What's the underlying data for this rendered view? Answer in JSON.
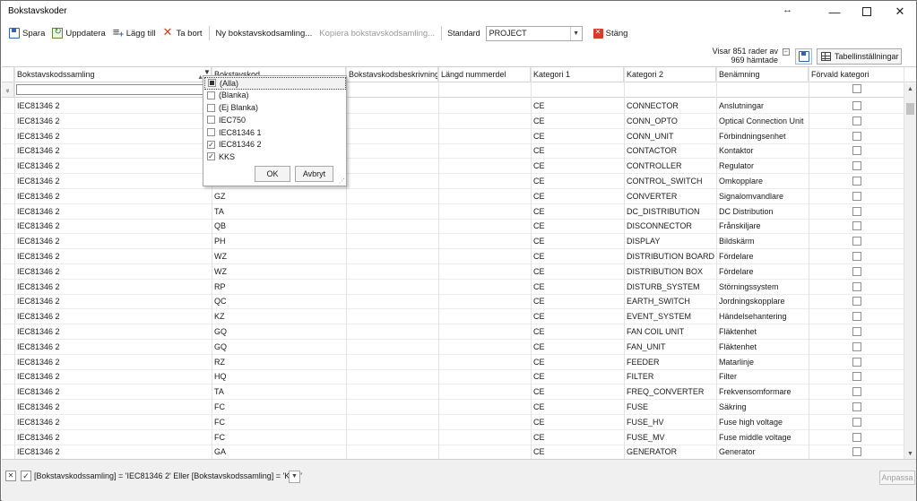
{
  "window": {
    "title": "Bokstavskoder"
  },
  "toolbar": {
    "save": "Spara",
    "update": "Uppdatera",
    "add": "Lägg till",
    "delete": "Ta bort",
    "new_collection": "Ny bokstavskodsamling...",
    "copy_collection": "Kopiera bokstavskodsamling...",
    "standard_label": "Standard",
    "standard_value": "PROJECT",
    "close": "Stäng"
  },
  "info": {
    "rows_line1": "Visar 851 rader av",
    "rows_line2": "969 hämtade",
    "settings_button": "Tabellinställningar"
  },
  "columns": [
    "Bokstavskodssamling",
    "Bokstavskod",
    "Bokstavskodsbeskrivning",
    "Längd nummerdel",
    "Kategori 1",
    "Kategori 2",
    "Benämning",
    "Förvald kategori"
  ],
  "rows": [
    {
      "collection": "IEC81346 2",
      "code": "",
      "cat1": "CE",
      "cat2": "CONNECTOR",
      "name": "Anslutningar"
    },
    {
      "collection": "IEC81346 2",
      "code": "",
      "cat1": "CE",
      "cat2": "CONN_OPTO",
      "name": "Optical Connection Unit"
    },
    {
      "collection": "IEC81346 2",
      "code": "",
      "cat1": "CE",
      "cat2": "CONN_UNIT",
      "name": "Förbindningsenhet"
    },
    {
      "collection": "IEC81346 2",
      "code": "",
      "cat1": "CE",
      "cat2": "CONTACTOR",
      "name": "Kontaktor"
    },
    {
      "collection": "IEC81346 2",
      "code": "",
      "cat1": "CE",
      "cat2": "CONTROLLER",
      "name": "Regulator"
    },
    {
      "collection": "IEC81346 2",
      "code": "",
      "cat1": "CE",
      "cat2": "CONTROL_SWITCH",
      "name": "Omkopplare"
    },
    {
      "collection": "IEC81346 2",
      "code": "GZ",
      "cat1": "CE",
      "cat2": "CONVERTER",
      "name": "Signalomvandlare"
    },
    {
      "collection": "IEC81346 2",
      "code": "TA",
      "cat1": "CE",
      "cat2": "DC_DISTRIBUTION",
      "name": "DC Distribution"
    },
    {
      "collection": "IEC81346 2",
      "code": "QB",
      "cat1": "CE",
      "cat2": "DISCONNECTOR",
      "name": "Frånskiljare"
    },
    {
      "collection": "IEC81346 2",
      "code": "PH",
      "cat1": "CE",
      "cat2": "DISPLAY",
      "name": "Bildskärm"
    },
    {
      "collection": "IEC81346 2",
      "code": "WZ",
      "cat1": "CE",
      "cat2": "DISTRIBUTION BOARD",
      "name": "Fördelare"
    },
    {
      "collection": "IEC81346 2",
      "code": "WZ",
      "cat1": "CE",
      "cat2": "DISTRIBUTION BOX",
      "name": "Fördelare"
    },
    {
      "collection": "IEC81346 2",
      "code": "RP",
      "cat1": "CE",
      "cat2": "DISTURB_SYSTEM",
      "name": "Störningssystem"
    },
    {
      "collection": "IEC81346 2",
      "code": "QC",
      "cat1": "CE",
      "cat2": "EARTH_SWITCH",
      "name": "Jordningskopplare"
    },
    {
      "collection": "IEC81346 2",
      "code": "KZ",
      "cat1": "CE",
      "cat2": "EVENT_SYSTEM",
      "name": "Händelsehantering"
    },
    {
      "collection": "IEC81346 2",
      "code": "GQ",
      "cat1": "CE",
      "cat2": "FAN COIL UNIT",
      "name": "Fläktenhet"
    },
    {
      "collection": "IEC81346 2",
      "code": "GQ",
      "cat1": "CE",
      "cat2": "FAN_UNIT",
      "name": "Fläktenhet"
    },
    {
      "collection": "IEC81346 2",
      "code": "RZ",
      "cat1": "CE",
      "cat2": "FEEDER",
      "name": "Matarlinje"
    },
    {
      "collection": "IEC81346 2",
      "code": "HQ",
      "cat1": "CE",
      "cat2": "FILTER",
      "name": "Filter"
    },
    {
      "collection": "IEC81346 2",
      "code": "TA",
      "cat1": "CE",
      "cat2": "FREQ_CONVERTER",
      "name": "Frekvensomformare"
    },
    {
      "collection": "IEC81346 2",
      "code": "FC",
      "cat1": "CE",
      "cat2": "FUSE",
      "name": "Säkring"
    },
    {
      "collection": "IEC81346 2",
      "code": "FC",
      "cat1": "CE",
      "cat2": "FUSE_HV",
      "name": "Fuse high voltage"
    },
    {
      "collection": "IEC81346 2",
      "code": "FC",
      "cat1": "CE",
      "cat2": "FUSE_MV",
      "name": "Fuse middle voltage"
    },
    {
      "collection": "IEC81346 2",
      "code": "GA",
      "cat1": "CE",
      "cat2": "GENERATOR",
      "name": "Generator"
    }
  ],
  "filter_dropdown": {
    "items": [
      {
        "label": "(Alla)",
        "state": "partial"
      },
      {
        "label": "(Blanka)",
        "state": "unchecked"
      },
      {
        "label": "(Ej Blanka)",
        "state": "unchecked"
      },
      {
        "label": "IEC750",
        "state": "unchecked"
      },
      {
        "label": "IEC81346 1",
        "state": "unchecked"
      },
      {
        "label": "IEC81346 2",
        "state": "checked"
      },
      {
        "label": "KKS",
        "state": "checked"
      }
    ],
    "ok": "OK",
    "cancel": "Avbryt"
  },
  "status": {
    "filter_expression": "[Bokstavskodssamling] = 'IEC81346 2' Eller [Bokstavskodssamling] = 'KKS'",
    "apply": "Anpassa"
  }
}
